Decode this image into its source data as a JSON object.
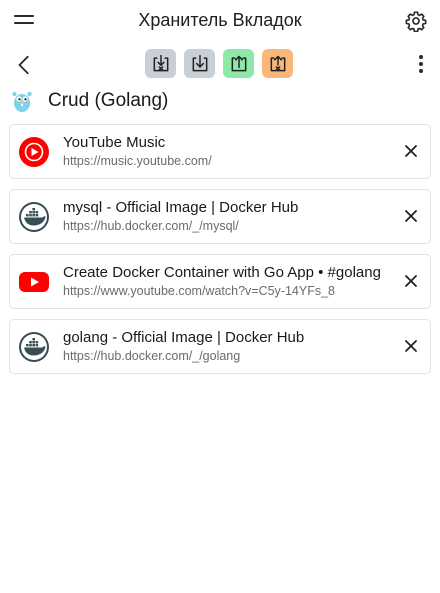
{
  "header": {
    "title": "Хранитель Вкладок"
  },
  "group": {
    "name": "Crud (Golang)"
  },
  "tabs": [
    {
      "title": "YouTube Music",
      "url": "https://music.youtube.com/",
      "icon": "youtube-music-icon"
    },
    {
      "title": "mysql - Official Image | Docker Hub",
      "url": "https://hub.docker.com/_/mysql/",
      "icon": "docker-icon"
    },
    {
      "title": "Create Docker Container with Go App • #golang",
      "url": "https://www.youtube.com/watch?v=C5y-14YFs_8",
      "icon": "youtube-icon"
    },
    {
      "title": "golang - Official Image | Docker Hub",
      "url": "https://hub.docker.com/_/golang",
      "icon": "docker-icon"
    }
  ],
  "colors": {
    "youtube_red": "#ff0000",
    "docker_dark": "#394d54",
    "action_gray": "#c9cfd6",
    "action_green": "#8ee8a8",
    "action_orange": "#f8b87a"
  }
}
